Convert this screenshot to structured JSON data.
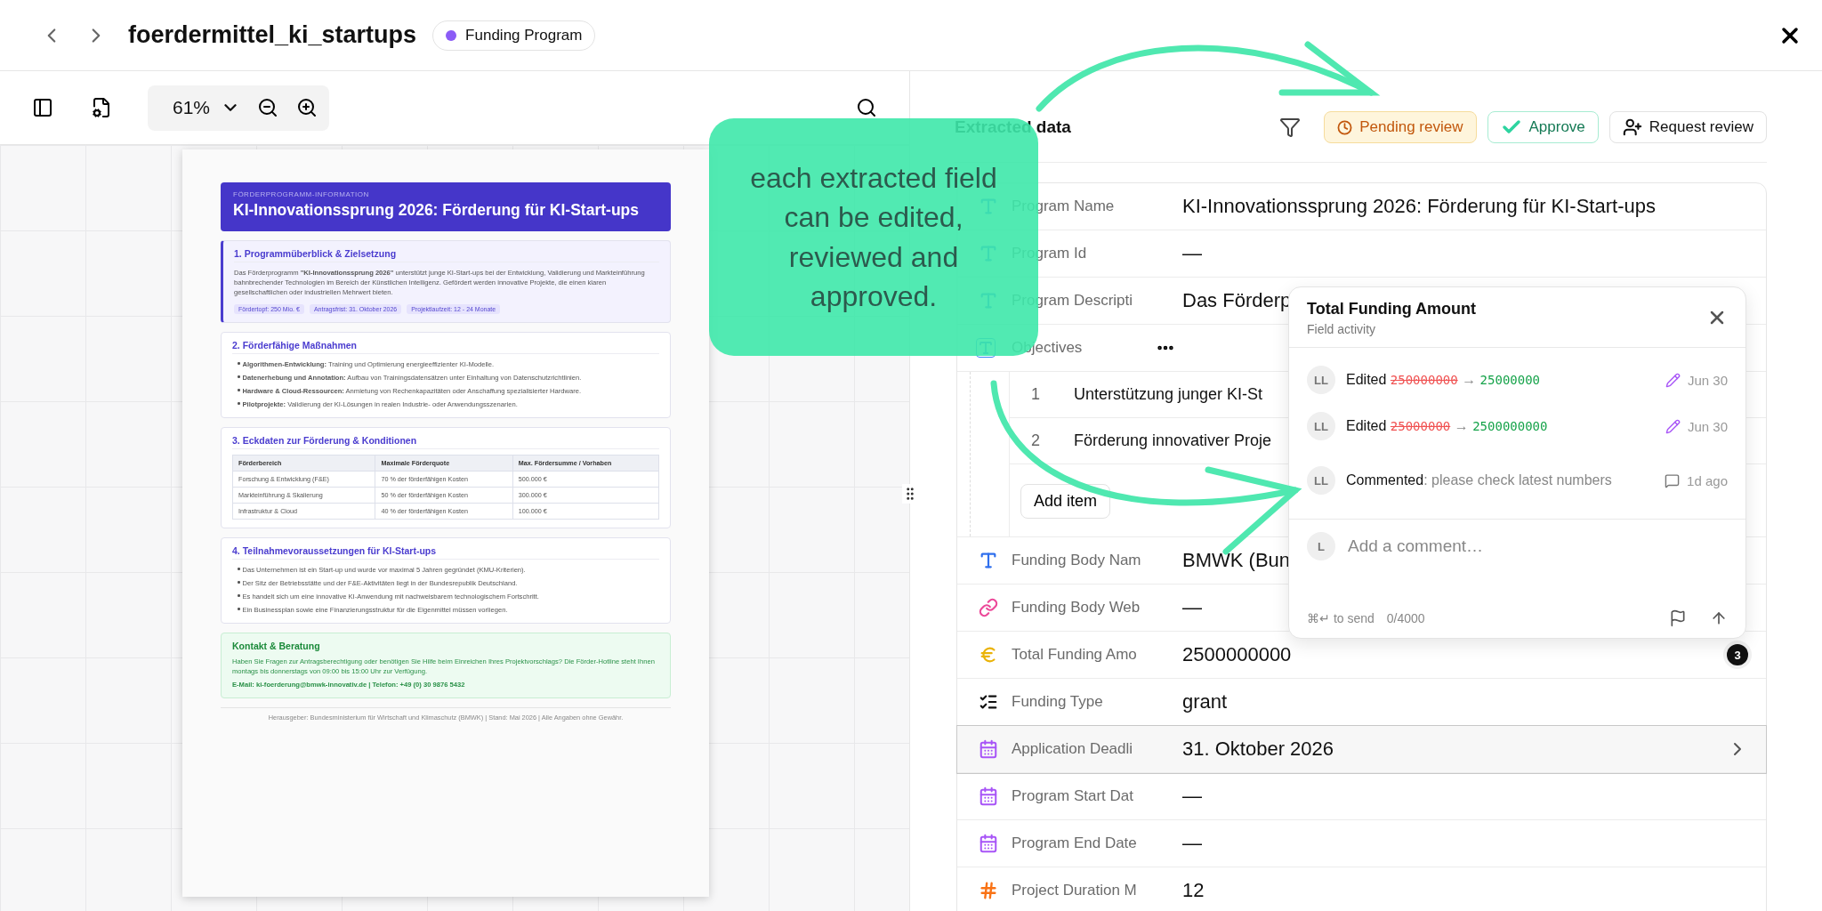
{
  "header": {
    "title": "foerdermittel_ki_startups",
    "badge": "Funding Program"
  },
  "viewer": {
    "zoom": "61%"
  },
  "document": {
    "eyebrow": "FÖRDERPROGRAMM-INFORMATION",
    "title": "KI-Innovationssprung 2026: Förderung für KI-Start-ups",
    "sections": [
      {
        "kind": "intro",
        "heading": "1. Programmüberblick & Zielsetzung",
        "text": "Das Förderprogramm **\"KI-Innovationssprung 2026\"** unterstützt junge KI-Start-ups bei der Entwicklung, Validierung und Markteinführung bahnbrechender Technologien im Bereich der Künstlichen Intelligenz. Gefördert werden innovative Projekte, die einen klaren gesellschaftlichen oder industriellen Mehrwert bieten.",
        "tags": [
          "Fördertopf: 250 Mio. €",
          "Antragsfrist: 31. Oktober 2026",
          "Projektlaufzeit: 12 - 24 Monate"
        ]
      },
      {
        "kind": "bullets",
        "heading": "2. Förderfähige Maßnahmen",
        "items": [
          "**Algorithmen-Entwicklung:** Training und Optimierung energieeffizienter KI-Modelle.",
          "**Datenerhebung und Annotation:** Aufbau von Trainingsdatensätzen unter Einhaltung von Datenschutzrichtlinien.",
          "**Hardware & Cloud-Ressourcen:** Anmietung von Rechenkapazitäten oder Anschaffung spezialisierter Hardware.",
          "**Pilotprojekte:** Validierung der KI-Lösungen in realen Industrie- oder Anwendungsszenarien."
        ]
      },
      {
        "kind": "table",
        "heading": "3. Eckdaten zur Förderung & Konditionen",
        "columns": [
          "Förderbereich",
          "Maximale Förderquote",
          "Max. Fördersumme / Vorhaben"
        ],
        "rows": [
          [
            "Forschung & Entwicklung (F&E)",
            "70 % der förderfähigen Kosten",
            "500.000 €"
          ],
          [
            "Markteinführung & Skalierung",
            "50 % der förderfähigen Kosten",
            "300.000 €"
          ],
          [
            "Infrastruktur & Cloud",
            "40 % der förderfähigen Kosten",
            "100.000 €"
          ]
        ]
      },
      {
        "kind": "bullets",
        "heading": "4. Teilnahmevoraussetzungen für KI-Start-ups",
        "items": [
          "Das Unternehmen ist ein Start-up und wurde vor maximal 5 Jahren gegründet (KMU-Kriterien).",
          "Der Sitz der Betriebsstätte und der F&E-Aktivitäten liegt in der Bundesrepublik Deutschland.",
          "Es handelt sich um eine innovative KI-Anwendung mit nachweisbarem technologischem Fortschritt.",
          "Ein Businessplan sowie eine Finanzierungsstruktur für die Eigenmittel müssen vorliegen."
        ]
      },
      {
        "kind": "contact",
        "heading": "Kontakt & Beratung",
        "text": "Haben Sie Fragen zur Antragsberechtigung oder benötigen Sie Hilfe beim Einreichen Ihres Projektvorschlags? Die Förder-Hotline steht Ihnen montags bis donnerstags von 09:00 bis 15:00 Uhr zur Verfügung.",
        "contact_line": "E-Mail: ki-foerderung@bmwk-innovativ.de | Telefon: +49 (0) 30 9876 5432"
      }
    ],
    "footer": "Herausgeber: Bundesministerium für Wirtschaft und Klimaschutz (BMWK) | Stand: Mai 2026 | Alle Angaben ohne Gewähr."
  },
  "extraction": {
    "title": "Extracted data",
    "status": "Pending review",
    "approve": "Approve",
    "request_review": "Request review",
    "fields": [
      {
        "kind": "text",
        "label": "Program Name",
        "value": "KI-Innovationssprung 2026: Förderung für KI-Start-ups",
        "selected": false
      },
      {
        "kind": "text",
        "label": "Program Id",
        "value": "—",
        "selected": false
      },
      {
        "kind": "text",
        "label": "Program Descripti",
        "value": "Das Förderp",
        "selected": false
      },
      {
        "kind": "list",
        "label": "Objectives",
        "selected": false,
        "items": [
          {
            "number": "1",
            "text": "Unterstützung junger KI-St"
          },
          {
            "number": "2",
            "text": "Förderung innovativer Proje"
          }
        ],
        "add_label": "Add item"
      },
      {
        "kind": "text",
        "label": "Funding Body Nam",
        "value": "BMWK (Bun",
        "selected": false
      },
      {
        "kind": "link",
        "label": "Funding Body Web",
        "value": "—",
        "selected": false
      },
      {
        "kind": "currency",
        "label": "Total Funding Amo",
        "value": "2500000000",
        "count": "3",
        "selected": false
      },
      {
        "kind": "choice",
        "label": "Funding Type",
        "value": "grant",
        "selected": false
      },
      {
        "kind": "date",
        "label": "Application Deadli",
        "value": "31. Oktober 2026",
        "selected": true
      },
      {
        "kind": "date",
        "label": "Program Start Dat",
        "value": "—",
        "selected": false
      },
      {
        "kind": "date",
        "label": "Program End Date",
        "value": "—",
        "selected": false
      },
      {
        "kind": "number",
        "label": "Project Duration M",
        "value": "12",
        "selected": false
      }
    ]
  },
  "activity": {
    "title": "Total Funding Amount",
    "subtitle": "Field activity",
    "entries": [
      {
        "kind": "edit",
        "author": "LL",
        "verb": "Edited",
        "old": "250000000",
        "separator": "→",
        "new": "25000000",
        "date": "Jun 30"
      },
      {
        "kind": "edit",
        "author": "LL",
        "verb": "Edited",
        "old": "25000000",
        "separator": "→",
        "new": "2500000000",
        "date": "Jun 30"
      },
      {
        "kind": "comment",
        "author": "LL",
        "verb": "Commented",
        "text": ": please check latest numbers",
        "date": "1d ago"
      }
    ],
    "composer": {
      "author": "L",
      "placeholder": "Add a comment…",
      "hint": "⌘↵ to send",
      "count": "0/4000"
    }
  },
  "callout": {
    "text": "each extracted field can be edited, reviewed and approved."
  }
}
